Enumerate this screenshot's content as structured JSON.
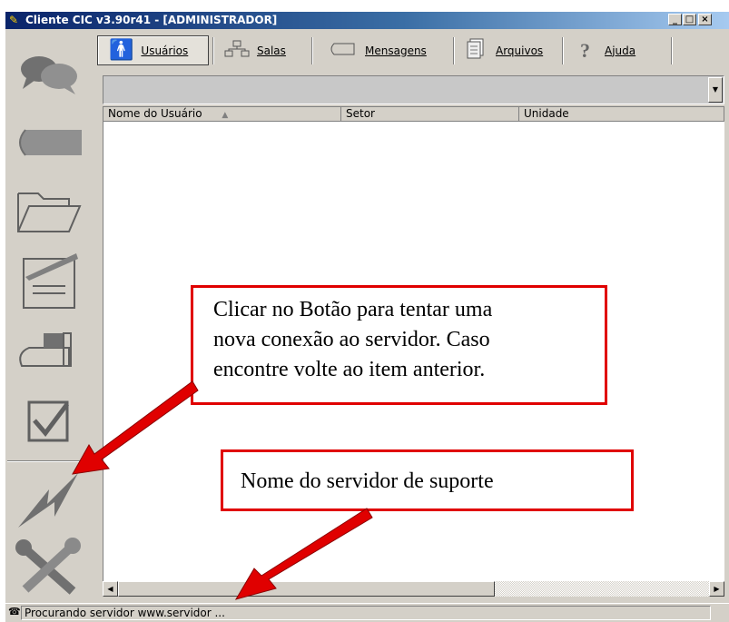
{
  "window": {
    "title": "Cliente CIC v3.90r41 - [ADMINISTRADOR]",
    "controls": [
      "_",
      "□",
      "×"
    ]
  },
  "sidebar": {
    "items": [
      {
        "icon": "chat-bubbles-icon"
      },
      {
        "icon": "message-tag-icon"
      },
      {
        "icon": "folder-icon"
      },
      {
        "icon": "edit-document-icon"
      },
      {
        "icon": "mailbox-icon"
      },
      {
        "icon": "checkbox-icon"
      },
      {
        "icon": "reconnect-lightning-icon"
      },
      {
        "icon": "tools-icon"
      }
    ]
  },
  "toolbar": {
    "buttons": [
      {
        "label": "Usuários",
        "icon": "user-icon",
        "active": true
      },
      {
        "label": "Salas",
        "icon": "network-icon",
        "active": false
      },
      {
        "label": "Mensagens",
        "icon": "messages-icon",
        "active": false
      },
      {
        "label": "Arquivos",
        "icon": "files-icon",
        "active": false
      },
      {
        "label": "Ajuda",
        "icon": "help-icon",
        "active": false
      }
    ]
  },
  "combo": {
    "value": ""
  },
  "listview": {
    "columns": [
      "Nome do Usuário",
      "Setor",
      "Unidade"
    ],
    "sort_indicator": "▲"
  },
  "statusbar": {
    "text": "Procurando servidor www.servidor ..."
  },
  "annotations": {
    "callout1": [
      "Clicar no Botão para tentar uma",
      "nova conexão ao servidor. Caso",
      "encontre volte ao item anterior."
    ],
    "callout2": "Nome do servidor de suporte",
    "arrow_color": "#e00000"
  },
  "colors": {
    "title_start": "#0a246a",
    "title_end": "#a6caf0",
    "face": "#d4d0c8",
    "annotation": "#e00000"
  }
}
